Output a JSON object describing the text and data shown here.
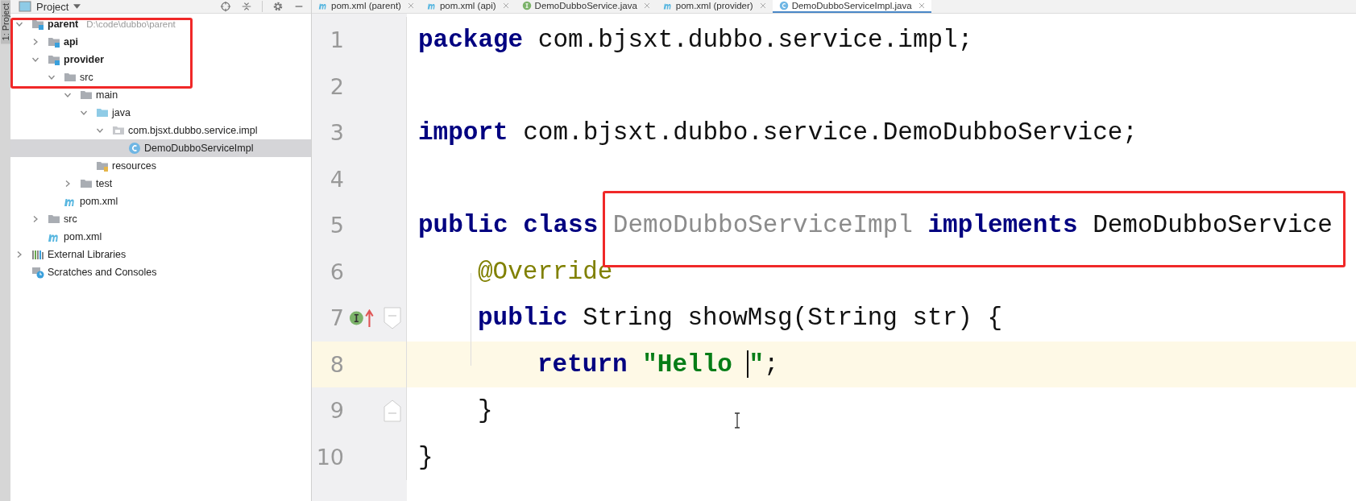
{
  "side_strip": {
    "label": "1: Project"
  },
  "project_panel": {
    "title": "Project",
    "tree": [
      {
        "label": "parent",
        "kind": "module",
        "hint": "D:\\code\\dubbo\\parent",
        "expanded": true,
        "selected": false,
        "children": [
          {
            "label": "api",
            "kind": "module",
            "expanded": false,
            "selected": false
          },
          {
            "label": "provider",
            "kind": "module",
            "expanded": true,
            "selected": false,
            "children": [
              {
                "label": "src",
                "kind": "folder",
                "expanded": true,
                "selected": false,
                "children": [
                  {
                    "label": "main",
                    "kind": "folder",
                    "expanded": true,
                    "selected": false,
                    "children": [
                      {
                        "label": "java",
                        "kind": "source",
                        "expanded": true,
                        "selected": false,
                        "children": [
                          {
                            "label": "com.bjsxt.dubbo.service.impl",
                            "kind": "package",
                            "expanded": true,
                            "selected": false,
                            "children": [
                              {
                                "label": "DemoDubboServiceImpl",
                                "kind": "class",
                                "selected": true
                              }
                            ]
                          }
                        ]
                      },
                      {
                        "label": "resources",
                        "kind": "resources",
                        "selected": false
                      }
                    ]
                  },
                  {
                    "label": "test",
                    "kind": "folder",
                    "expanded": false,
                    "selected": false
                  }
                ]
              },
              {
                "label": "pom.xml",
                "kind": "maven",
                "selected": false
              }
            ]
          },
          {
            "label": "src",
            "kind": "folder",
            "expanded": false,
            "selected": false
          },
          {
            "label": "pom.xml",
            "kind": "maven",
            "selected": false
          }
        ]
      },
      {
        "label": "External Libraries",
        "kind": "libraries",
        "expanded": false,
        "selected": false
      },
      {
        "label": "Scratches and Consoles",
        "kind": "scratches",
        "selected": false
      }
    ]
  },
  "tabs": [
    {
      "label": "pom.xml (parent)",
      "kind": "maven",
      "selected": false
    },
    {
      "label": "pom.xml (api)",
      "kind": "maven",
      "selected": false
    },
    {
      "label": "DemoDubboService.java",
      "kind": "interface",
      "selected": false
    },
    {
      "label": "pom.xml (provider)",
      "kind": "maven",
      "selected": false
    },
    {
      "label": "DemoDubboServiceImpl.java",
      "kind": "class",
      "selected": true
    }
  ],
  "editor": {
    "lines": [
      {
        "number": "1",
        "kind": "top",
        "current": false,
        "tokens": [
          {
            "kind": "keyword",
            "text": "package"
          },
          {
            "kind": "plain",
            "text": "com.bjsxt.dubbo.service.impl;",
            "space_before": true
          }
        ]
      },
      {
        "number": "2",
        "current": false
      },
      {
        "number": "3",
        "kind": "top",
        "current": false,
        "tokens": [
          {
            "kind": "keyword",
            "text": "import"
          },
          {
            "kind": "plain",
            "text": "com.bjsxt.dubbo.service.DemoDubboService;",
            "space_before": true
          }
        ]
      },
      {
        "number": "4",
        "current": false
      },
      {
        "number": "5",
        "kind": "top",
        "current": false,
        "tokens": [
          {
            "kind": "keyword",
            "text": "public class"
          },
          {
            "kind": "unused",
            "text": "DemoDubboServiceImpl",
            "space_before": true
          },
          {
            "kind": "keyword",
            "text": "implements",
            "space_before": true
          },
          {
            "kind": "plain",
            "text": "DemoDubboService",
            "space_before": true
          }
        ]
      },
      {
        "number": "6",
        "kind": "member",
        "current": false,
        "tokens": [
          {
            "kind": "annotation",
            "text": "@Override"
          }
        ]
      },
      {
        "number": "7",
        "kind": "member",
        "current": false,
        "implements_marker": true,
        "fold_start": true,
        "tokens": [
          {
            "kind": "keyword",
            "text": "public"
          },
          {
            "kind": "plain",
            "text": "String showMsg(String str) {",
            "space_before": true
          }
        ]
      },
      {
        "number": "8",
        "kind": "statement",
        "current": true,
        "tokens": [
          {
            "kind": "keyword",
            "text": "return"
          },
          {
            "kind": "string",
            "text": "\"Hello ",
            "space_before": true
          },
          {
            "kind": "caret"
          },
          {
            "kind": "string",
            "text": "\""
          },
          {
            "kind": "plain",
            "text": ";"
          }
        ]
      },
      {
        "number": "9",
        "kind": "member",
        "current": false,
        "fold_end": true,
        "tokens": [
          {
            "kind": "plain",
            "text": "}"
          }
        ]
      },
      {
        "number": "10",
        "kind": "top",
        "current": false,
        "tokens": [
          {
            "kind": "plain",
            "text": "}"
          }
        ]
      }
    ]
  }
}
